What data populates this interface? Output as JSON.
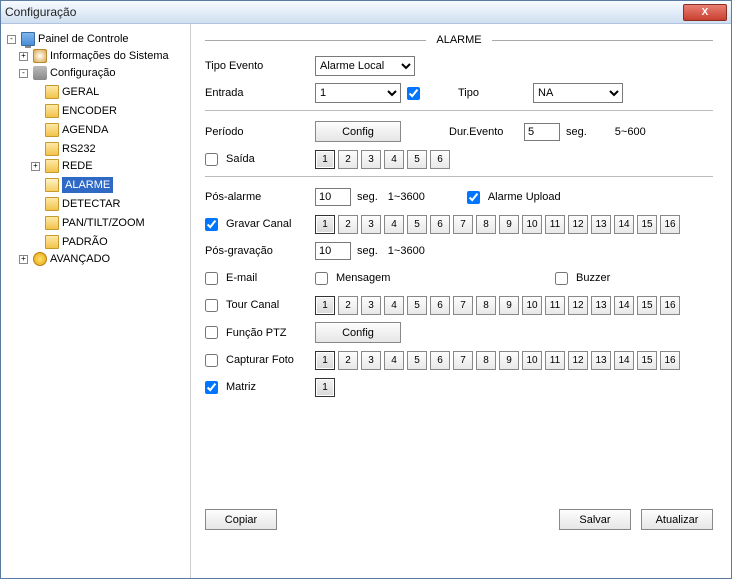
{
  "window": {
    "title": "Configuração"
  },
  "close_label": "X",
  "tree": {
    "painel": "Painel de Controle",
    "info": "Informações do Sistema",
    "config": "Configuração",
    "items": {
      "geral": "GERAL",
      "encoder": "ENCODER",
      "agenda": "AGENDA",
      "rs232": "RS232",
      "rede": "REDE",
      "alarme": "ALARME",
      "detectar": "DETECTAR",
      "ptz": "PAN/TILT/ZOOM",
      "padrao": "PADRÃO"
    },
    "avancado": "AVANÇADO",
    "toggle_plus": "+",
    "toggle_minus": "-"
  },
  "panel": {
    "section": "ALARME",
    "tipo_evento_label": "Tipo Evento",
    "tipo_evento_value": "Alarme Local",
    "entrada_label": "Entrada",
    "entrada_value": "1",
    "tipo_label": "Tipo",
    "tipo_value": "NA",
    "periodo_label": "Período",
    "config_btn": "Config",
    "dur_label": "Dur.Evento",
    "dur_value": "5",
    "seg": "seg.",
    "dur_range": "5~600",
    "saida_label": "Saída",
    "pos_alarme_label": "Pós-alarme",
    "pos_alarme_value": "10",
    "pos_alarme_range": "1~3600",
    "alarme_upload": "Alarme Upload",
    "gravar_canal": "Gravar Canal",
    "pos_gravacao_label": "Pós-gravação",
    "pos_gravacao_value": "10",
    "pos_gravacao_range": "1~3600",
    "email": "E-mail",
    "mensagem": "Mensagem",
    "buzzer": "Buzzer",
    "tour_canal": "Tour Canal",
    "funcao_ptz": "Função PTZ",
    "capturar_foto": "Capturar Foto",
    "matriz": "Matriz",
    "matriz_value": "1",
    "channels6": [
      "1",
      "2",
      "3",
      "4",
      "5",
      "6"
    ],
    "channels16": [
      "1",
      "2",
      "3",
      "4",
      "5",
      "6",
      "7",
      "8",
      "9",
      "10",
      "11",
      "12",
      "13",
      "14",
      "15",
      "16"
    ]
  },
  "footer": {
    "copiar": "Copiar",
    "salvar": "Salvar",
    "atualizar": "Atualizar"
  }
}
